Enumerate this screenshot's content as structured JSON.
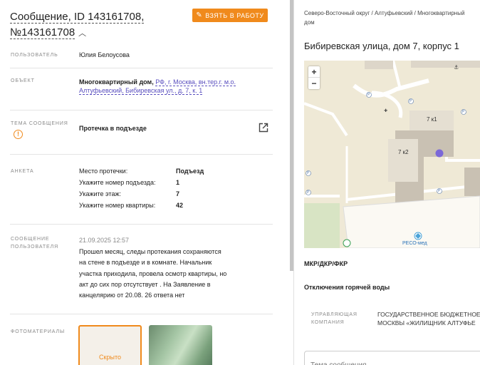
{
  "message": {
    "title": "Сообщение, ID 143161708, №143161708",
    "take_button": "ВЗЯТЬ В РАБОТУ"
  },
  "fields": {
    "user": {
      "label": "ПОЛЬЗОВАТЕЛЬ",
      "value": "Юлия Белоусова"
    },
    "object": {
      "label": "ОБЪЕКТ",
      "type": "Многоквартирный дом,",
      "link": "РФ, г. Москва, вн.тер.г. м.о. Алтуфьевский, Бибиревская ул., д. 7, к. 1"
    },
    "topic": {
      "label": "ТЕМА СООБЩЕНИЯ",
      "value": "Протечка в подъезде"
    },
    "survey": {
      "label": "АНКЕТА",
      "rows": [
        {
          "q": "Место протечки:",
          "a": "Подъезд"
        },
        {
          "q": "Укажите номер подъезда:",
          "a": "1"
        },
        {
          "q": "Укажите этаж:",
          "a": "7"
        },
        {
          "q": "Укажите номер квартиры:",
          "a": "42"
        }
      ]
    },
    "user_message": {
      "label": "СООБЩЕНИЕ ПОЛЬЗОВАТЕЛЯ",
      "date": "21.09.2025 12:57",
      "text": "Прошел месяц, следы протекания сохраняются на стене в подъезде и в комнате. Начальник участка приходила, провела осмотр квартиры, но акт до сих пор отсутствует . На Заявление в канцелярию от 20.08. 26 ответа нет"
    },
    "photos": {
      "label": "ФОТОМАТЕРИАЛЫ",
      "hidden_label": "Скрыто"
    }
  },
  "right": {
    "breadcrumbs": "Северо-Восточный округ / Алтуфьевский / Многоквартирный дом",
    "address": "Бибиревская улица, дом 7, корпус 1",
    "map": {
      "zoom_in": "+",
      "zoom_out": "−",
      "building_1": "7 к1",
      "building_2": "7 к2",
      "poi_label": "РЕСО-мед",
      "parking": "P"
    },
    "mkr_label": "МКР/ДКР/ФКР",
    "hot_water_label": "Отключения горячей воды",
    "management": {
      "label": "УПРАВЛЯЮЩАЯ КОМПАНИЯ",
      "value_line1": "ГОСУДАРСТВЕННОЕ БЮДЖЕТНОЕ",
      "value_line2": "МОСКВЫ «ЖИЛИЩНИК АЛТУФЬЕ"
    },
    "topic_placeholder": "Тема сообщения"
  },
  "colors": {
    "accent": "#f08a1c",
    "link": "#5a4fbf",
    "marker": "#7b68d8"
  }
}
